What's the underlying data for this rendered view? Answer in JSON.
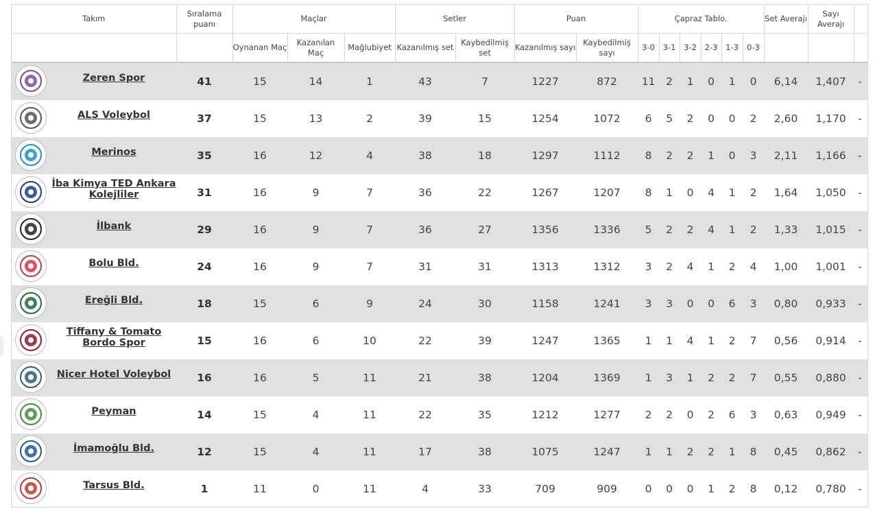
{
  "header": {
    "team": "Takım",
    "rank_points": "Sıralama puanı",
    "matches": "Maçlar",
    "sets": "Setler",
    "points": "Puan",
    "cross_table": "Çapraz Tablo.",
    "set_avg": "Set Averajı",
    "point_avg": "Sayı Averajı",
    "played": "Oynanan Maç",
    "won": "Kazanılan Maç",
    "lost": "Mağlubiyet",
    "sets_won": "Kazanılmış set",
    "sets_lost": "Kaybedilmiş set",
    "pts_won": "Kazanılmış sayı",
    "pts_lost": "Kaybedilmiş sayı",
    "c30": "3-0",
    "c31": "3-1",
    "c32": "3-2",
    "c23": "2-3",
    "c13": "1-3",
    "c03": "0-3"
  },
  "rows": [
    {
      "team": "Zeren Spor",
      "pts": "41",
      "om": "15",
      "km": "14",
      "mg": "1",
      "ks": "43",
      "kbs": "7",
      "ksay": "1227",
      "kbsay": "872",
      "c30": "11",
      "c31": "2",
      "c32": "1",
      "c23": "0",
      "c13": "1",
      "c03": "0",
      "savg": "6,14",
      "pavg": "1,407",
      "extra": "-",
      "logo": "zeren-spor-logo",
      "logo_color": "#7b4a9e"
    },
    {
      "team": "ALS Voleybol",
      "pts": "37",
      "om": "15",
      "km": "13",
      "mg": "2",
      "ks": "39",
      "kbs": "15",
      "ksay": "1254",
      "kbsay": "1072",
      "c30": "6",
      "c31": "5",
      "c32": "2",
      "c23": "0",
      "c13": "0",
      "c03": "2",
      "savg": "2,60",
      "pavg": "1,170",
      "extra": "-",
      "logo": "als-voleybol-logo",
      "logo_color": "#555555"
    },
    {
      "team": "Merinos",
      "pts": "35",
      "om": "16",
      "km": "12",
      "mg": "4",
      "ks": "38",
      "kbs": "18",
      "ksay": "1297",
      "kbsay": "1112",
      "c30": "8",
      "c31": "2",
      "c32": "2",
      "c23": "1",
      "c13": "0",
      "c03": "3",
      "savg": "2,11",
      "pavg": "1,166",
      "extra": "-",
      "logo": "merinos-logo",
      "logo_color": "#1e90c8"
    },
    {
      "team": "İba Kimya TED Ankara Kolejliler",
      "pts": "31",
      "om": "16",
      "km": "9",
      "mg": "7",
      "ks": "36",
      "kbs": "22",
      "ksay": "1267",
      "kbsay": "1207",
      "c30": "8",
      "c31": "1",
      "c32": "0",
      "c23": "4",
      "c13": "1",
      "c03": "2",
      "savg": "1,64",
      "pavg": "1,050",
      "extra": "-",
      "logo": "ted-ankara-logo",
      "logo_color": "#1a3c8e"
    },
    {
      "team": "İlbank",
      "pts": "29",
      "om": "16",
      "km": "9",
      "mg": "7",
      "ks": "36",
      "kbs": "27",
      "ksay": "1356",
      "kbsay": "1336",
      "c30": "5",
      "c31": "2",
      "c32": "2",
      "c23": "4",
      "c13": "1",
      "c03": "2",
      "savg": "1,33",
      "pavg": "1,015",
      "extra": "-",
      "logo": "ilbank-logo",
      "logo_color": "#222222"
    },
    {
      "team": "Bolu Bld.",
      "pts": "24",
      "om": "16",
      "km": "9",
      "mg": "7",
      "ks": "31",
      "kbs": "31",
      "ksay": "1313",
      "kbsay": "1312",
      "c30": "3",
      "c31": "2",
      "c32": "4",
      "c23": "1",
      "c13": "2",
      "c03": "4",
      "savg": "1,00",
      "pavg": "1,001",
      "extra": "-",
      "logo": "bolu-bld-logo",
      "logo_color": "#d6304a"
    },
    {
      "team": "Ereğli Bld.",
      "pts": "18",
      "om": "15",
      "km": "6",
      "mg": "9",
      "ks": "24",
      "kbs": "30",
      "ksay": "1158",
      "kbsay": "1241",
      "c30": "3",
      "c31": "3",
      "c32": "0",
      "c23": "0",
      "c13": "6",
      "c03": "3",
      "savg": "0,80",
      "pavg": "0,933",
      "extra": "-",
      "logo": "eregli-bld-logo",
      "logo_color": "#1f6b3a"
    },
    {
      "team": "Tiffany & Tomato Bordo Spor",
      "pts": "15",
      "om": "16",
      "km": "6",
      "mg": "10",
      "ks": "22",
      "kbs": "39",
      "ksay": "1247",
      "kbsay": "1365",
      "c30": "1",
      "c31": "1",
      "c32": "4",
      "c23": "1",
      "c13": "2",
      "c03": "7",
      "savg": "0,56",
      "pavg": "0,914",
      "extra": "-",
      "logo": "bordo-spor-logo",
      "logo_color": "#8b1a2b"
    },
    {
      "team": "Nicer Hotel Voleybol",
      "pts": "16",
      "om": "16",
      "km": "5",
      "mg": "11",
      "ks": "21",
      "kbs": "38",
      "ksay": "1204",
      "kbsay": "1369",
      "c30": "1",
      "c31": "3",
      "c32": "1",
      "c23": "2",
      "c13": "2",
      "c03": "7",
      "savg": "0,55",
      "pavg": "0,880",
      "extra": "-",
      "logo": "nicer-hotel-logo",
      "logo_color": "#2a5f6e"
    },
    {
      "team": "Peyman",
      "pts": "14",
      "om": "15",
      "km": "4",
      "mg": "11",
      "ks": "22",
      "kbs": "35",
      "ksay": "1212",
      "kbsay": "1277",
      "c30": "2",
      "c31": "2",
      "c32": "0",
      "c23": "2",
      "c13": "6",
      "c03": "3",
      "savg": "0,63",
      "pavg": "0,949",
      "extra": "-",
      "logo": "peyman-logo",
      "logo_color": "#3f8f3a"
    },
    {
      "team": "İmamoğlu Bld.",
      "pts": "12",
      "om": "15",
      "km": "4",
      "mg": "11",
      "ks": "17",
      "kbs": "38",
      "ksay": "1075",
      "kbsay": "1247",
      "c30": "1",
      "c31": "1",
      "c32": "2",
      "c23": "2",
      "c13": "1",
      "c03": "8",
      "savg": "0,45",
      "pavg": "0,862",
      "extra": "-",
      "logo": "imamoglu-bld-logo",
      "logo_color": "#1d56a6"
    },
    {
      "team": "Tarsus Bld.",
      "pts": "1",
      "om": "11",
      "km": "0",
      "mg": "11",
      "ks": "4",
      "kbs": "33",
      "ksay": "709",
      "kbsay": "909",
      "c30": "0",
      "c31": "0",
      "c32": "0",
      "c23": "1",
      "c13": "2",
      "c03": "8",
      "savg": "0,12",
      "pavg": "0,780",
      "extra": "-",
      "logo": "tarsus-bld-logo",
      "logo_color": "#c0392b"
    }
  ]
}
